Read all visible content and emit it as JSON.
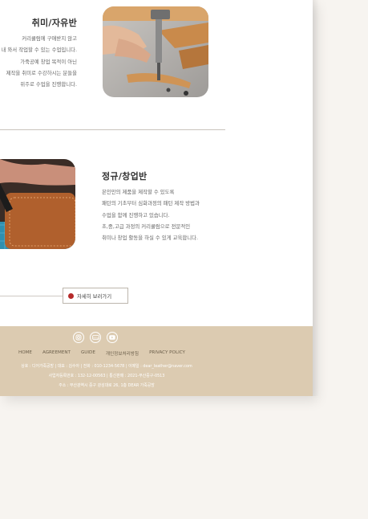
{
  "section1": {
    "title": "취미/자유반",
    "lines": [
      "커리큘럼에 구애받지 않고",
      "내 와서 작업할 수 있는 수업입니다.",
      "가죽공예 창업 목적이 아닌",
      "제작을 취미로 수강하시는 분들을",
      "위주로 수업을 진행합니다."
    ]
  },
  "section2": {
    "title": "정규/창업반",
    "lines": [
      "본인만의 제품을 제작할 수 있도록",
      "패턴의 기초부터 심화과정의 패턴 제작 방법과",
      "수업을 함께 진행하고 있습니다.",
      "초,중,고급 과정의 커리큘럼으로 전문적인",
      "취미나 창업 활동을 하실 수 있게 교육합니다."
    ]
  },
  "more_button": {
    "label": "자세히 보러가기"
  },
  "footer": {
    "social_icons": [
      "instagram-icon",
      "blog-icon",
      "youtube-icon"
    ],
    "nav": [
      "HOME",
      "AGREEMENT",
      "GUIDE",
      "개인정보처리방침",
      "PRIVACY POLICY"
    ],
    "info": [
      "상호 : 디어가죽공방 | 대표 : 김수아 | 전화 : 010-1234-5678 | 이메일 : dear_leather@naver.com",
      "사업자등록번호 : 132-12-00563 | 통신판매 : 2021-부산중구-0513",
      "주소 : 부산광역시 중구 광성대로 26, 1층 DEAR 가죽공방"
    ]
  },
  "colors": {
    "footer_bg": "#dccbb1",
    "accent_dot": "#b52a2a",
    "page_bg": "#f7f4f0"
  }
}
